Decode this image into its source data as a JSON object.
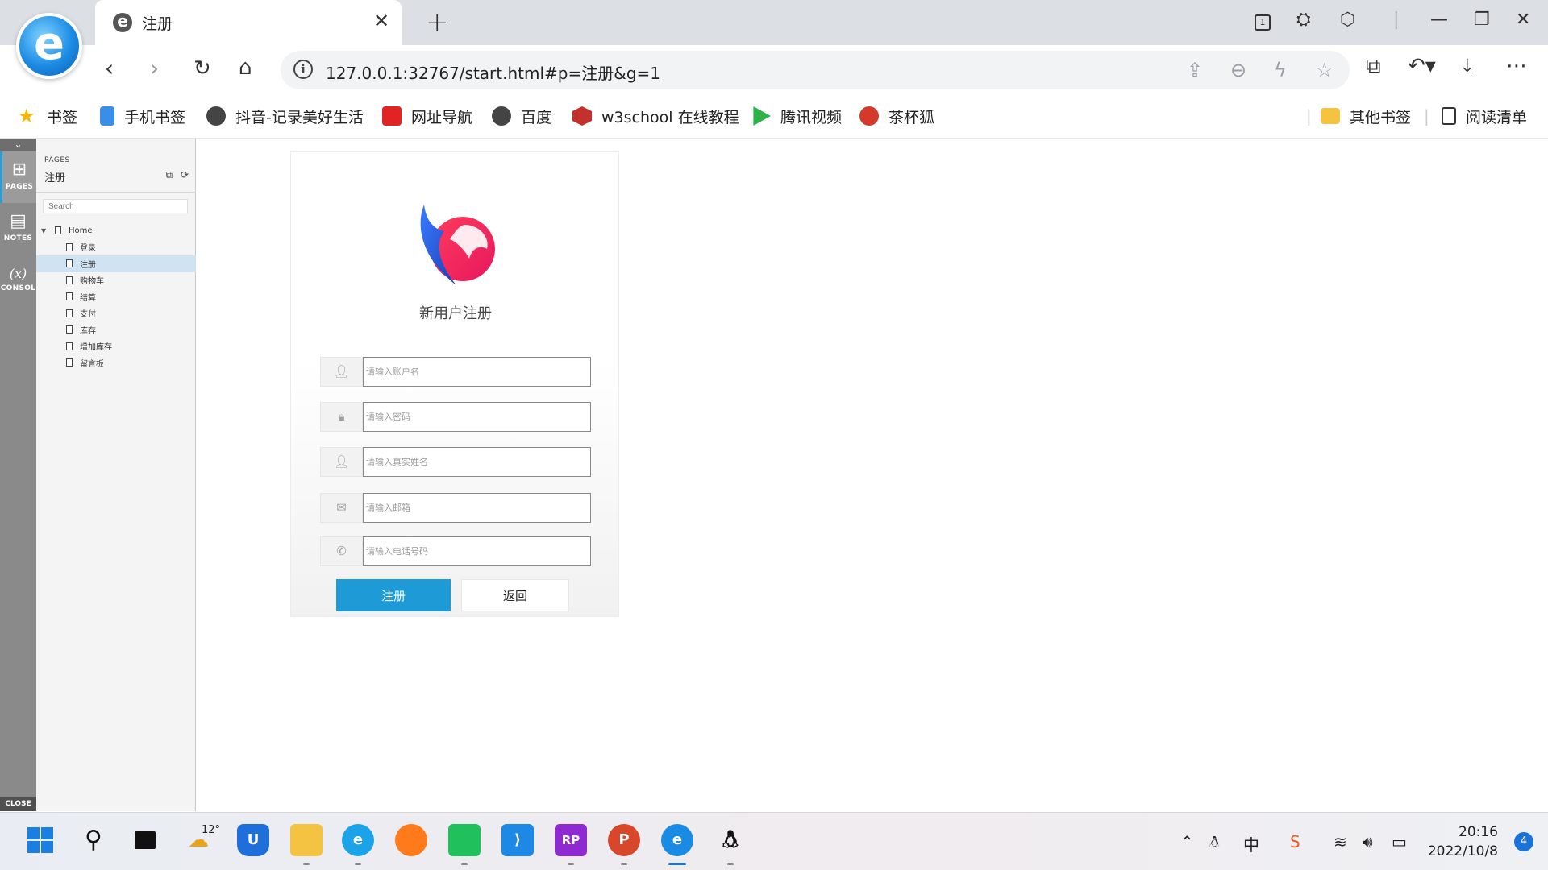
{
  "browser": {
    "tab_title": "注册",
    "address": "127.0.0.1:32767/start.html#p=注册&g=1",
    "tab_count": "1"
  },
  "bookmarks": [
    {
      "label": "书签",
      "icon": "star-icon",
      "color": "#f5b400"
    },
    {
      "label": "手机书签",
      "icon": "phone-bookmark-icon",
      "color": "#3a8ee6"
    },
    {
      "label": "抖音-记录美好生活",
      "icon": "douyin-icon",
      "color": "#444444"
    },
    {
      "label": "网址导航",
      "icon": "nav-site-icon",
      "color": "#e02424"
    },
    {
      "label": "百度",
      "icon": "baidu-icon",
      "color": "#444444"
    },
    {
      "label": "w3school 在线教程",
      "icon": "w3school-icon",
      "color": "#c4302b"
    },
    {
      "label": "腾讯视频",
      "icon": "tencent-video-icon",
      "color": "#2fb14a"
    },
    {
      "label": "茶杯狐",
      "icon": "chabeihu-icon",
      "color": "#d33a2c"
    }
  ],
  "bookmarks_right": [
    {
      "label": "其他书签",
      "icon": "folder-icon",
      "color": "#f5c342"
    },
    {
      "label": "阅读清单",
      "icon": "reading-list-icon",
      "color": "#333333"
    }
  ],
  "sidebar": {
    "pages_label": "PAGES",
    "notes_label": "NOTES",
    "console_label": "CONSOL",
    "close_label": "CLOSE"
  },
  "pages_panel": {
    "header": "PAGES",
    "current_page": "注册",
    "search_placeholder": "Search",
    "tree": [
      {
        "label": "Home",
        "level": 0
      },
      {
        "label": "登录",
        "level": 1
      },
      {
        "label": "注册",
        "level": 1,
        "selected": true
      },
      {
        "label": "购物车",
        "level": 1
      },
      {
        "label": "结算",
        "level": 1
      },
      {
        "label": "支付",
        "level": 1
      },
      {
        "label": "库存",
        "level": 1
      },
      {
        "label": "增加库存",
        "level": 1
      },
      {
        "label": "留言板",
        "level": 1
      }
    ]
  },
  "register": {
    "title": "新用户注册",
    "fields": [
      {
        "placeholder": "请输入账户名",
        "icon": "user-icon"
      },
      {
        "placeholder": "请输入密码",
        "icon": "lock-icon"
      },
      {
        "placeholder": "请输入真实姓名",
        "icon": "user-icon"
      },
      {
        "placeholder": "请输入邮箱",
        "icon": "mail-icon"
      },
      {
        "placeholder": "请输入电话号码",
        "icon": "phone-icon"
      }
    ],
    "submit_label": "注册",
    "back_label": "返回",
    "accent": "#1e9ad6"
  },
  "taskbar": {
    "weather_temp": "12°",
    "time": "20:16",
    "date": "2022/10/8",
    "notification_count": "4",
    "ime": "中"
  }
}
